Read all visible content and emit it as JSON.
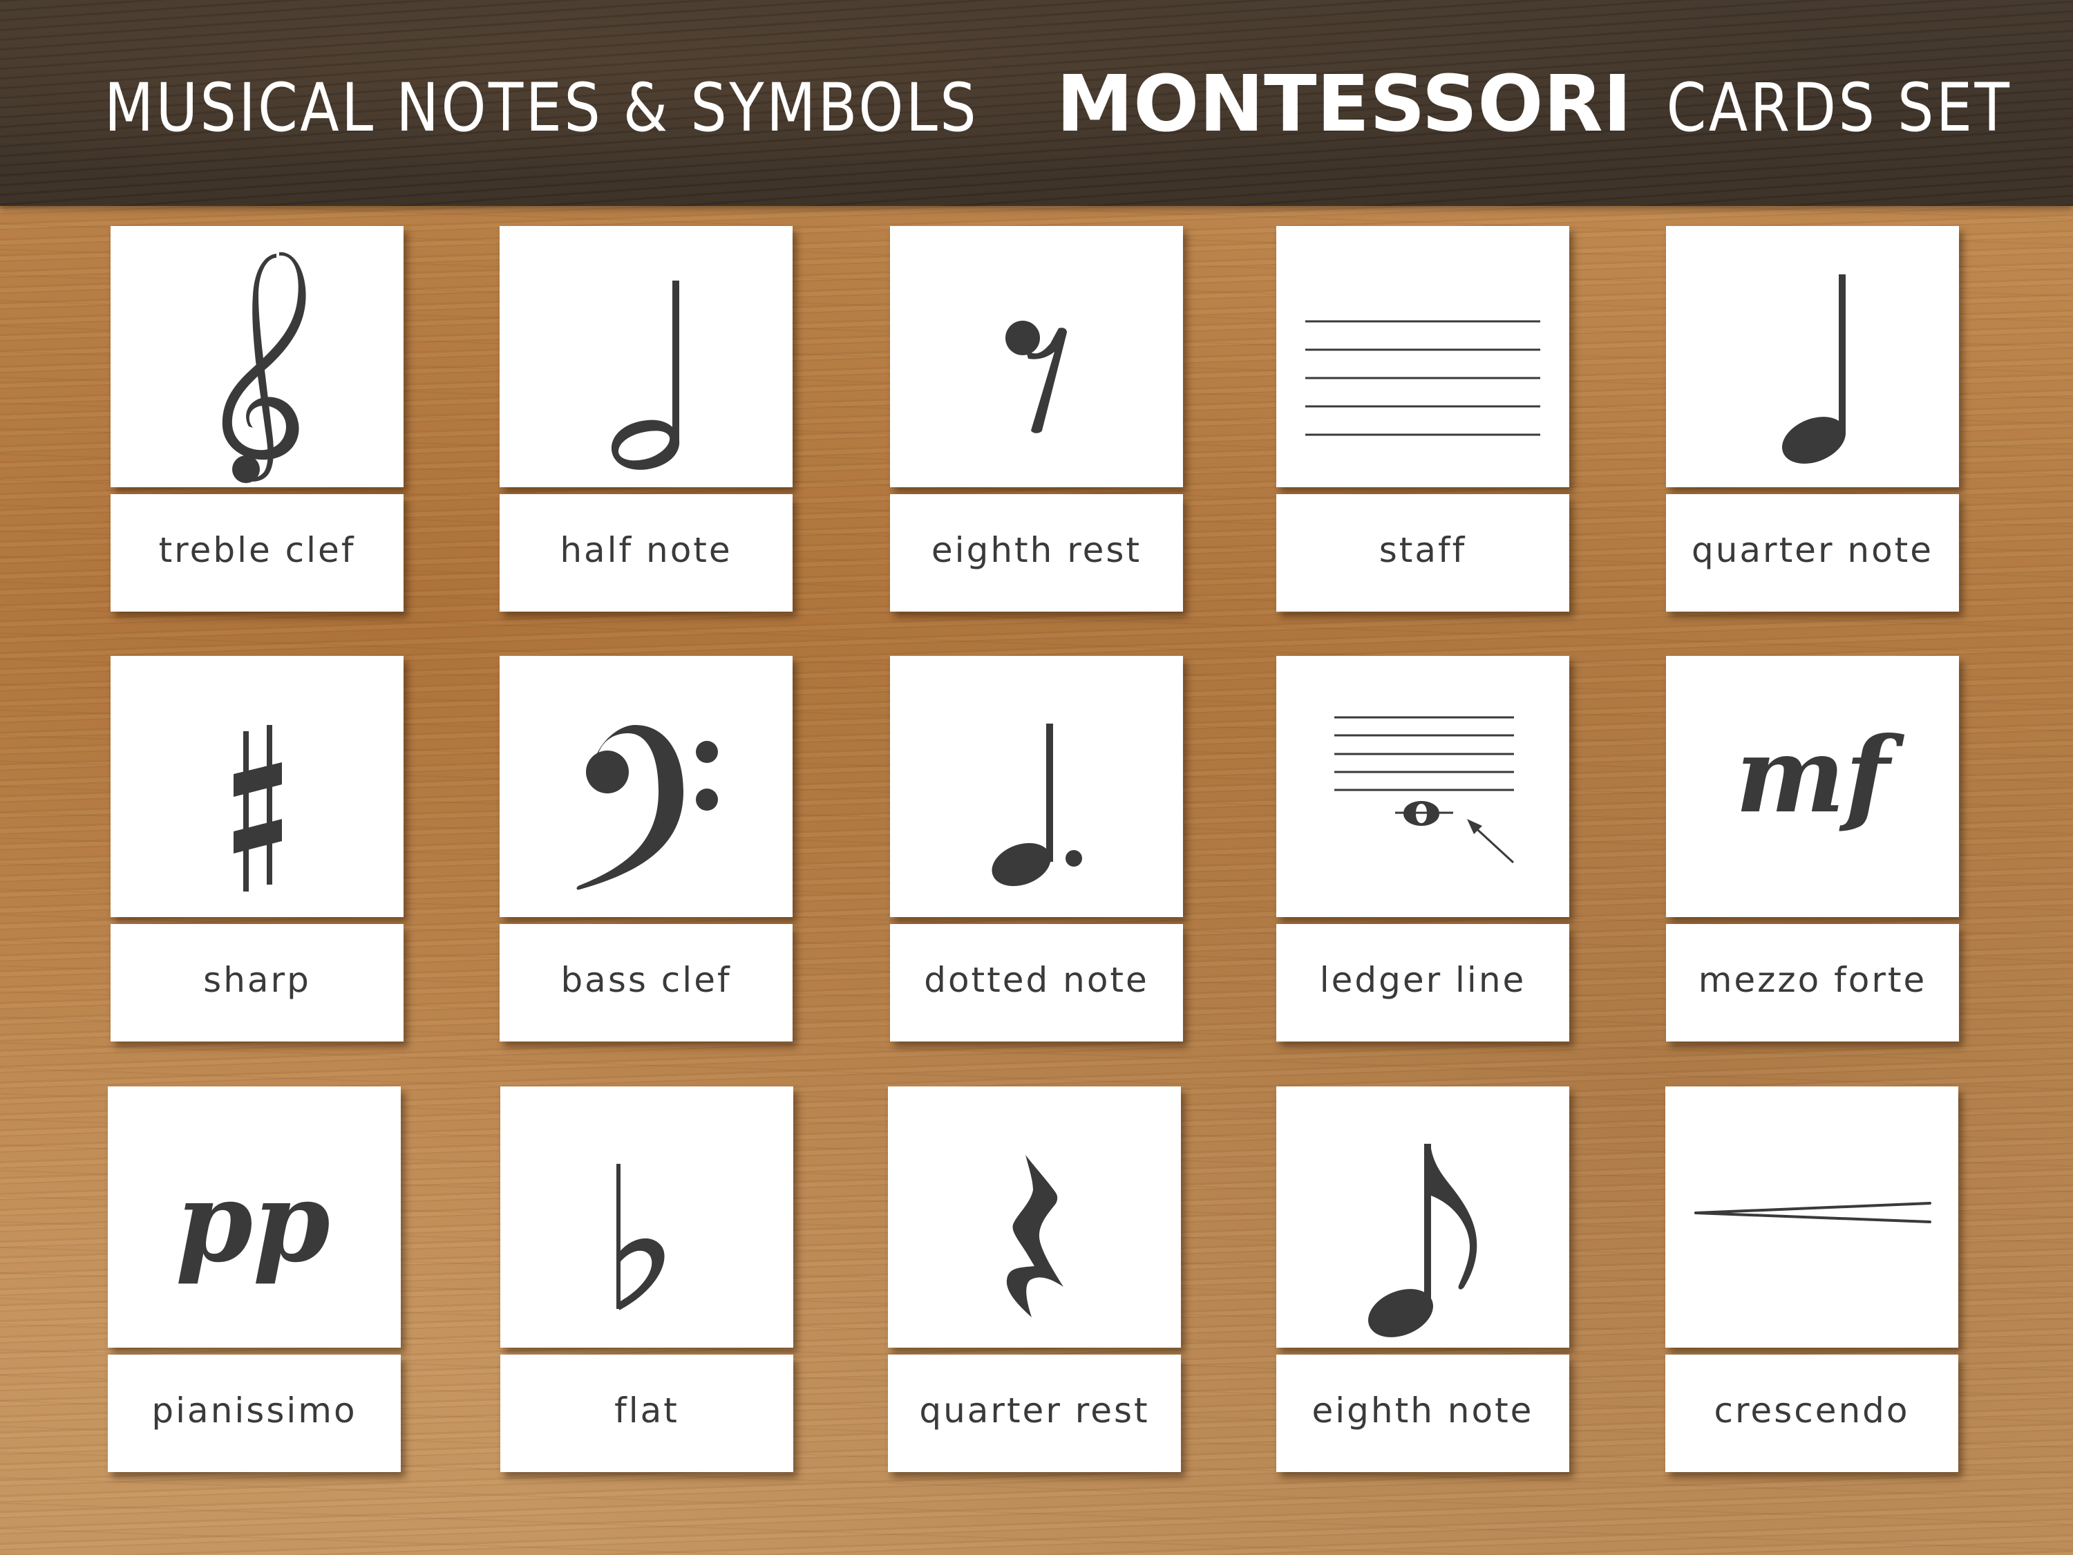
{
  "header": {
    "title_part1": "MUSICAL NOTES & SYMBOLS",
    "title_emphasis": "MONTESSORI",
    "title_part2": "CARDS SET"
  },
  "colors": {
    "header_bg": "#3d3128",
    "wood": "#c08a52",
    "card": "#ffffff",
    "ink": "#3a3a3a"
  },
  "cards": [
    {
      "label": "treble clef",
      "symbol": "treble-clef"
    },
    {
      "label": "half note",
      "symbol": "half-note"
    },
    {
      "label": "eighth rest",
      "symbol": "eighth-rest"
    },
    {
      "label": "staff",
      "symbol": "staff"
    },
    {
      "label": "quarter note",
      "symbol": "quarter-note"
    },
    {
      "label": "sharp",
      "symbol": "sharp"
    },
    {
      "label": "bass clef",
      "symbol": "bass-clef"
    },
    {
      "label": "dotted note",
      "symbol": "dotted-note"
    },
    {
      "label": "ledger line",
      "symbol": "ledger-line"
    },
    {
      "label": "mezzo forte",
      "symbol": "mezzo-forte",
      "glyph": "mf"
    },
    {
      "label": "pianissimo",
      "symbol": "pianissimo",
      "glyph": "pp"
    },
    {
      "label": "flat",
      "symbol": "flat"
    },
    {
      "label": "quarter rest",
      "symbol": "quarter-rest"
    },
    {
      "label": "eighth note",
      "symbol": "eighth-note"
    },
    {
      "label": "crescendo",
      "symbol": "crescendo"
    }
  ]
}
